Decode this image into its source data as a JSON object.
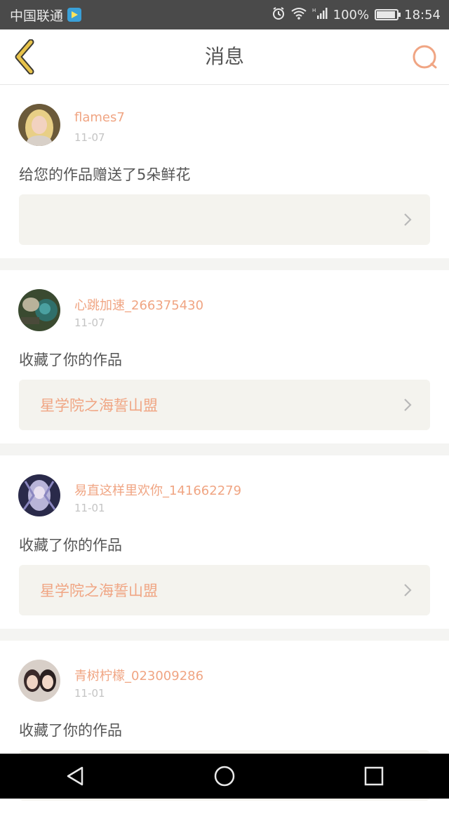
{
  "status_bar": {
    "carrier": "中国联通",
    "battery": "100%",
    "time": "18:54"
  },
  "header": {
    "title": "消息"
  },
  "colors": {
    "accent": "#f0a583",
    "back_icon": "#e8c34a"
  },
  "messages": [
    {
      "username": "flames7",
      "date": "11-07",
      "text": "给您的作品赠送了5朵鲜花",
      "work_title": ""
    },
    {
      "username": "心跳加速_266375430",
      "date": "11-07",
      "text": "收藏了你的作品",
      "work_title": "星学院之海誓山盟"
    },
    {
      "username": "易直这样里欢你_141662279",
      "date": "11-01",
      "text": "收藏了你的作品",
      "work_title": "星学院之海誓山盟"
    },
    {
      "username": "青树柠檬_023009286",
      "date": "11-01",
      "text": "收藏了你的作品",
      "work_title": ""
    }
  ]
}
